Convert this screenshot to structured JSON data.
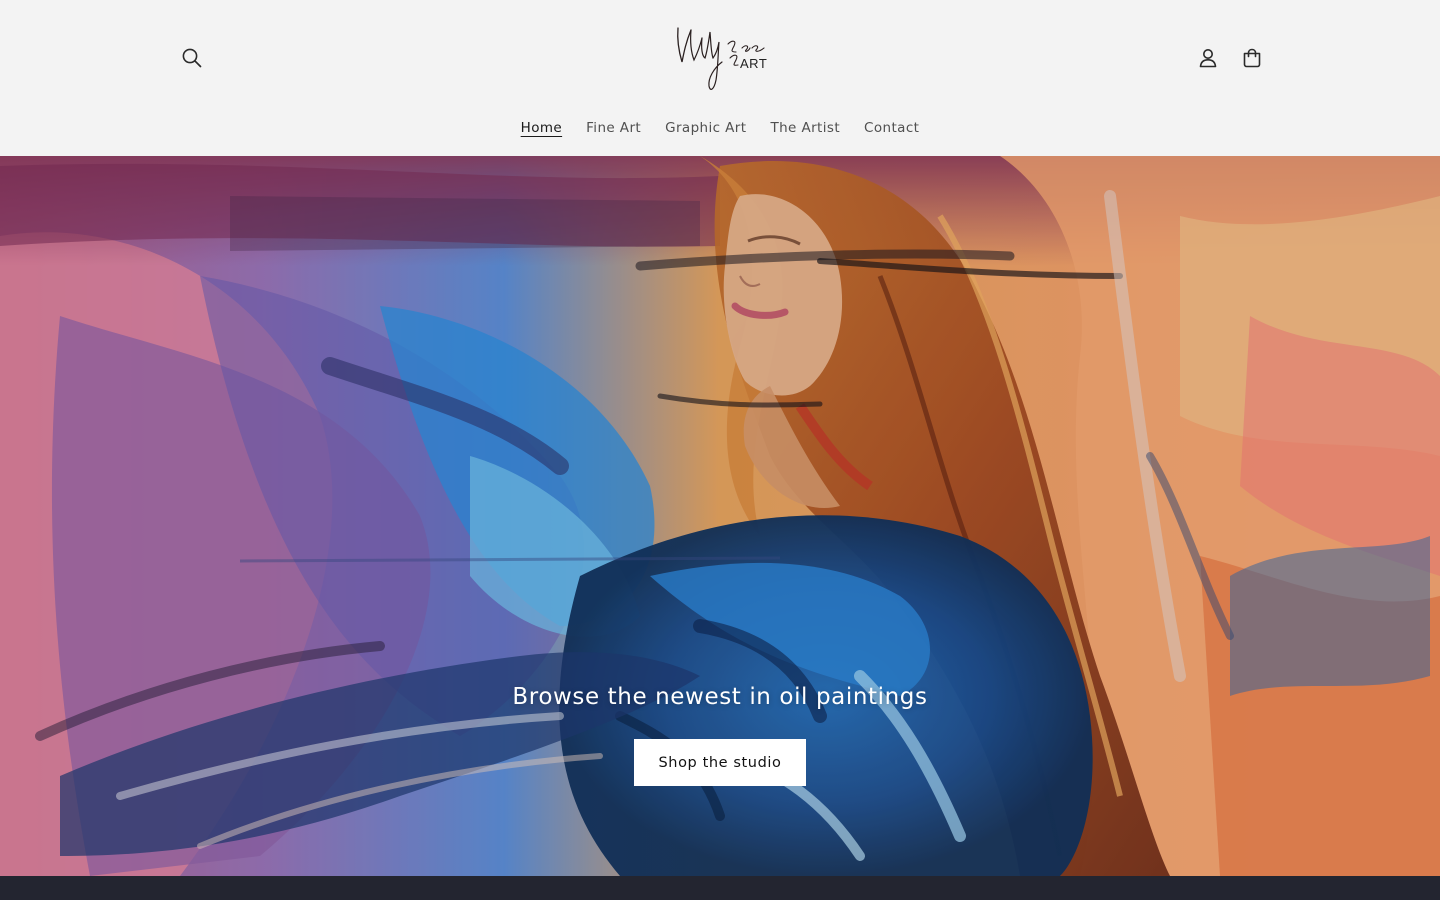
{
  "header": {
    "logo_text": "ART",
    "icons": {
      "search": "search-icon",
      "account": "account-icon",
      "cart": "cart-icon"
    }
  },
  "nav": {
    "items": [
      {
        "label": "Home",
        "active": true
      },
      {
        "label": "Fine Art",
        "active": false
      },
      {
        "label": "Graphic Art",
        "active": false
      },
      {
        "label": "The Artist",
        "active": false
      },
      {
        "label": "Contact",
        "active": false
      }
    ]
  },
  "hero": {
    "heading": "Browse the newest in oil paintings",
    "button_label": "Shop the studio"
  },
  "colors": {
    "background": "#f3f3f3",
    "text": "#121212",
    "footer": "#232530",
    "button_bg": "#ffffff"
  }
}
